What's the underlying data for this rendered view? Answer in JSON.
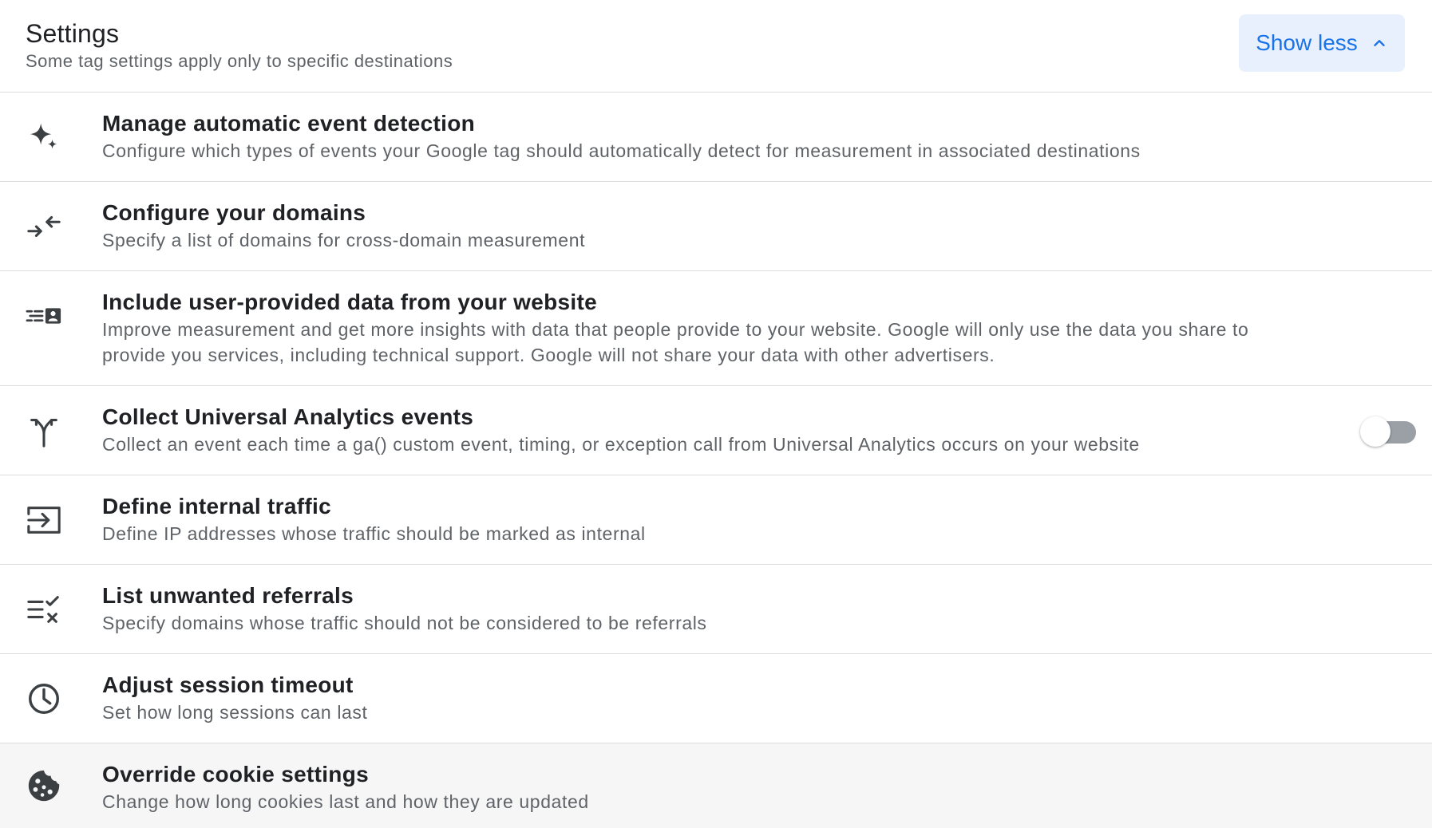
{
  "header": {
    "title": "Settings",
    "subtitle": "Some tag settings apply only to specific destinations",
    "toggle_button_label": "Show less",
    "toggle_button_icon": "chevron-up-icon",
    "accent_color": "#1a73e8"
  },
  "settings": [
    {
      "icon": "sparkle-icon",
      "title": "Manage automatic event detection",
      "description": "Configure which types of events your Google tag should automatically detect for measurement in associated destinations"
    },
    {
      "icon": "arrows-inward-icon",
      "title": "Configure your domains",
      "description": "Specify a list of domains for cross-domain measurement"
    },
    {
      "icon": "user-data-icon",
      "title": "Include user-provided data from your website",
      "description": "Improve measurement and get more insights with data that people provide to your website. Google will only use the data you share to provide you services, including technical support. Google will not share your data with other advertisers."
    },
    {
      "icon": "fork-arrows-icon",
      "title": "Collect Universal Analytics events",
      "description": "Collect an event each time a ga() custom event, timing, or exception call from Universal Analytics occurs on your website",
      "toggle_on": false
    },
    {
      "icon": "input-arrow-icon",
      "title": "Define internal traffic",
      "description": "Define IP addresses whose traffic should be marked as internal"
    },
    {
      "icon": "list-check-x-icon",
      "title": "List unwanted referrals",
      "description": "Specify domains whose traffic should not be considered to be referrals"
    },
    {
      "icon": "clock-icon",
      "title": "Adjust session timeout",
      "description": "Set how long sessions can last"
    },
    {
      "icon": "cookie-icon",
      "title": "Override cookie settings",
      "description": "Change how long cookies last and how they are updated"
    }
  ]
}
